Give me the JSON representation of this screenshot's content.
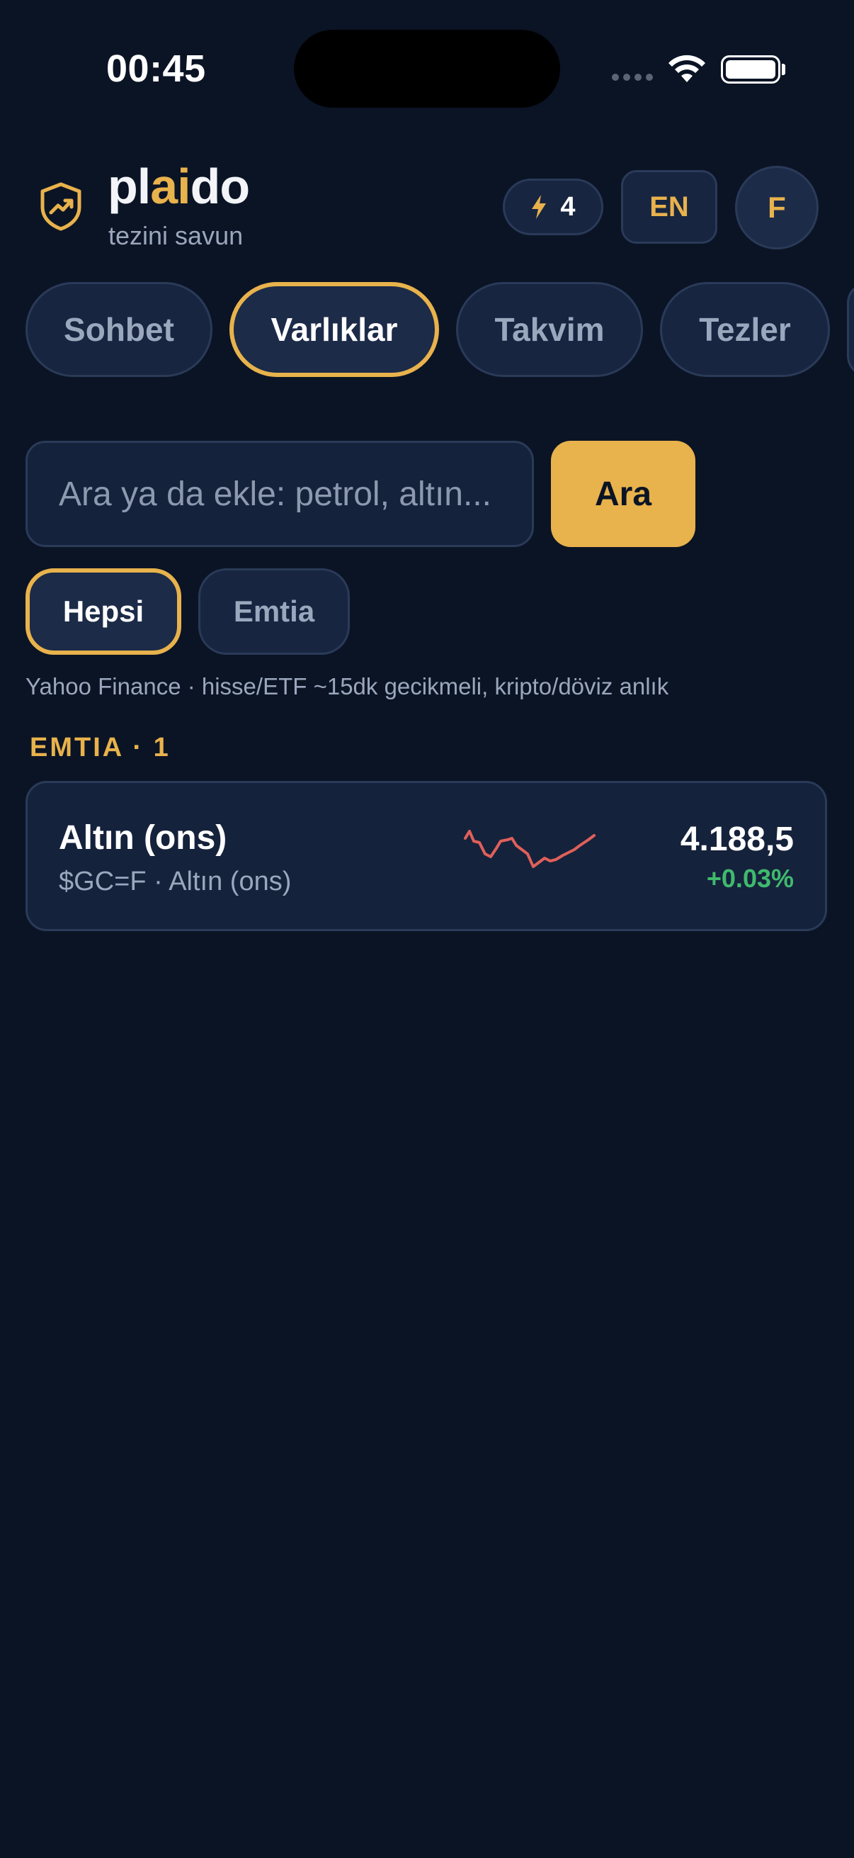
{
  "status_bar": {
    "time": "00:45"
  },
  "header": {
    "brand_part1": "pl",
    "brand_part2": "ai",
    "brand_part3": "do",
    "tagline": "tezini savun",
    "credits": "4",
    "language": "EN",
    "avatar_initial": "F"
  },
  "tabs": [
    {
      "label": "Sohbet",
      "active": false
    },
    {
      "label": "Varlıklar",
      "active": true
    },
    {
      "label": "Takvim",
      "active": false
    },
    {
      "label": "Tezler",
      "active": false
    }
  ],
  "search": {
    "placeholder": "Ara ya da ekle: petrol, altın...",
    "button_label": "Ara"
  },
  "filters": [
    {
      "label": "Hepsi",
      "active": true
    },
    {
      "label": "Emtia",
      "active": false
    }
  ],
  "source_note": "Yahoo Finance · hisse/ETF ~15dk gecikmeli, kripto/döviz anlık",
  "section": {
    "title": "EMTIA · 1"
  },
  "assets": [
    {
      "name": "Altın (ons)",
      "subtitle": "$GC=F · Altın (ons)",
      "price": "4.188,5",
      "change": "+0.03%"
    }
  ],
  "colors": {
    "background": "#0b1425",
    "accent": "#e8b24c",
    "positive": "#3fba6d",
    "sparkline": "#e0605a"
  }
}
